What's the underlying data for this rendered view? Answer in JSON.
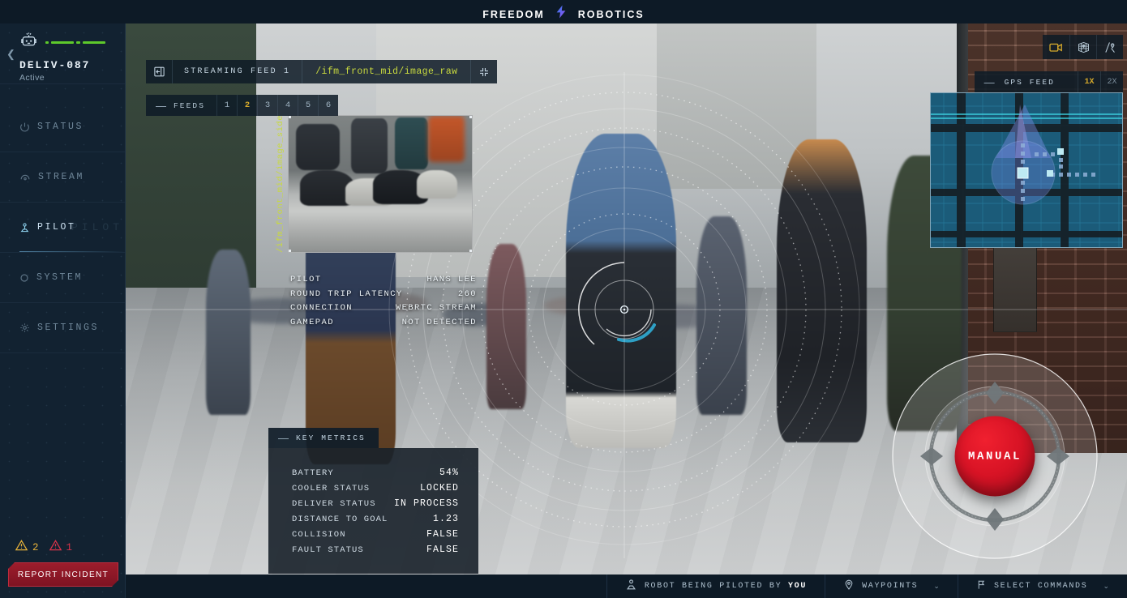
{
  "brand": {
    "name_left": "FREEDOM",
    "name_right": "ROBOTICS",
    "bolt_color_a": "#2f7ef0",
    "bolt_color_b": "#9a4df0"
  },
  "sidebar": {
    "robot": {
      "name": "DELIV-087",
      "state": "Active",
      "signal_color": "#5ec92b"
    },
    "items": [
      {
        "label": "STATUS",
        "icon": "power-icon",
        "active": false
      },
      {
        "label": "STREAM",
        "icon": "stream-icon",
        "active": false
      },
      {
        "label": "PILOT",
        "icon": "joystick-icon",
        "active": true,
        "ghost": "PILOT"
      },
      {
        "label": "SYSTEM",
        "icon": "circle-icon",
        "active": false
      },
      {
        "label": "SETTINGS",
        "icon": "gear-icon",
        "active": false
      }
    ],
    "warnings": [
      {
        "level": "amber",
        "count": "2",
        "color": "#e5b13a"
      },
      {
        "level": "red",
        "count": "1",
        "color": "#d9334a"
      }
    ],
    "report_button": "REPORT INCIDENT"
  },
  "stream": {
    "title": "STREAMING FEED 1",
    "path": "/ifm_front_mid/image_raw",
    "path_color": "#c8d93f",
    "feeds_label": "FEEDS",
    "feeds": [
      "1",
      "2",
      "3",
      "4",
      "5",
      "6"
    ],
    "selected_feed": "2",
    "selected_color": "#d8ab2b",
    "side_feed_path": "/ifm_front_mid/image_side"
  },
  "pilot_info": {
    "rows": [
      {
        "key": "PILOT",
        "value": "HANS LEE"
      },
      {
        "key": "ROUND TRIP LATENCY",
        "value": "260"
      },
      {
        "key": "CONNECTION",
        "value": "WEBRTC STREAM"
      },
      {
        "key": "GAMEPAD",
        "value": "NOT DETECTED"
      }
    ]
  },
  "key_metrics": {
    "title": "KEY METRICS",
    "rows": [
      {
        "key": "BATTERY",
        "value": "54%"
      },
      {
        "key": "COOLER STATUS",
        "value": "LOCKED"
      },
      {
        "key": "DELIVER STATUS",
        "value": "IN PROCESS"
      },
      {
        "key": "DISTANCE TO GOAL",
        "value": "1.23"
      },
      {
        "key": "COLLISION",
        "value": "FALSE"
      },
      {
        "key": "FAULT STATUS",
        "value": "FALSE"
      }
    ]
  },
  "camera_tools": [
    {
      "icon": "video-camera-icon",
      "active": true
    },
    {
      "icon": "map-pin-grid-icon",
      "active": false
    },
    {
      "icon": "route-compass-icon",
      "active": false
    }
  ],
  "gps": {
    "title": "GPS FEED",
    "zoom_levels": [
      "1X",
      "2X"
    ],
    "selected_zoom": "1X"
  },
  "manual_control": {
    "label": "MANUAL",
    "color": "#d81325"
  },
  "bottom_bar": {
    "piloted_prefix": "ROBOT BEING PILOTED BY ",
    "piloted_who": "YOU",
    "waypoints": "WAYPOINTS",
    "commands": "SELECT COMMANDS",
    "chevron": "⌄"
  }
}
